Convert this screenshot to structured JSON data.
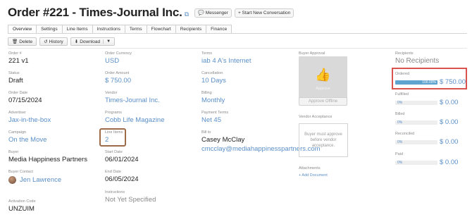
{
  "header": {
    "title": "Order #221 - Times-Journal Inc.",
    "messenger_label": "Messenger",
    "new_conversation_label": "+ Start New Conversation"
  },
  "tabs": [
    {
      "label": "Overview",
      "active": true
    },
    {
      "label": "Settings"
    },
    {
      "label": "Line Items"
    },
    {
      "label": "Instructions"
    },
    {
      "label": "Terms"
    },
    {
      "label": "Flowchart"
    },
    {
      "label": "Recipients"
    },
    {
      "label": "Finance"
    }
  ],
  "toolbar": {
    "delete_label": "Delete",
    "history_label": "History",
    "download_label": "Download"
  },
  "fields": {
    "order_num": {
      "label": "Order #",
      "value": "221 v1"
    },
    "status": {
      "label": "Status",
      "value": "Draft"
    },
    "order_date": {
      "label": "Order Date",
      "value": "07/15/2024"
    },
    "advertiser": {
      "label": "Advertiser",
      "value": "Jax-in-the-box"
    },
    "campaign": {
      "label": "Campaign",
      "value": "On the Move"
    },
    "buyer": {
      "label": "Buyer",
      "value": "Media Happiness Partners"
    },
    "buyer_contact": {
      "label": "Buyer Contact",
      "value": "Jen Lawrence"
    },
    "activation_code": {
      "label": "Activation Code",
      "value": "UNZUIM"
    },
    "order_currency": {
      "label": "Order Currency",
      "value": "USD"
    },
    "order_amount": {
      "label": "Order Amount",
      "value": "$ 750.00"
    },
    "vendor": {
      "label": "Vendor",
      "value": "Times-Journal Inc."
    },
    "programs": {
      "label": "Programs",
      "value": "Cobb Life Magazine"
    },
    "line_items": {
      "label": "Line Items",
      "value": "2"
    },
    "start_date": {
      "label": "Start Date",
      "value": "06/01/2024"
    },
    "end_date": {
      "label": "End Date",
      "value": "06/05/2024"
    },
    "instructions": {
      "label": "Instructions",
      "value": "Not Yet Specified"
    },
    "terms": {
      "label": "Terms",
      "value": "iab 4 A's Internet"
    },
    "cancellation": {
      "label": "Cancellation",
      "value": "10 Days"
    },
    "billing": {
      "label": "Billing",
      "value": "Monthly"
    },
    "payment_terms": {
      "label": "Payment Terms",
      "value": "Net 45"
    },
    "bill_to": {
      "label": "Bill to",
      "value": "Casey McClay",
      "email": "cmcclay@mediahappinesspartners.com"
    }
  },
  "approval": {
    "label": "Buyer Approval",
    "approve_text": "Approve",
    "approve_offline_label": "Approve Offline",
    "vendor_acceptance_label": "Vendor Acceptance",
    "vendor_acceptance_text": "Buyer must approve before vendor acceptance.",
    "attachments_label": "Attachments",
    "add_document_label": "+ Add Document"
  },
  "recipients": {
    "label": "Recipients",
    "no_recipients": "No Recipients",
    "finance": [
      {
        "label": "Ordered",
        "percent": "100.00%",
        "fraction": 1.0,
        "amount": "$ 750.00"
      },
      {
        "label": "Fulfilled",
        "percent": "0%",
        "fraction": 0,
        "amount": "$ 0.00"
      },
      {
        "label": "Billed",
        "percent": "0%",
        "fraction": 0,
        "amount": "$ 0.00"
      },
      {
        "label": "Reconciled",
        "percent": "0%",
        "fraction": 0,
        "amount": "$ 0.00"
      },
      {
        "label": "Paid",
        "percent": "0%",
        "fraction": 0,
        "amount": "$ 0.00"
      }
    ]
  },
  "colors": {
    "link": "#5b8fc7",
    "highlight_border": "#9b6b4a",
    "red_box": "#d9534f",
    "progress_fill": "#5fa4cf"
  }
}
